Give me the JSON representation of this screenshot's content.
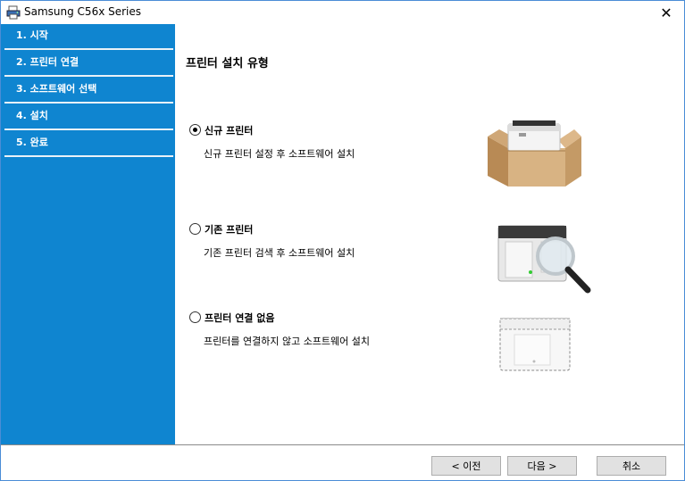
{
  "window": {
    "title": "Samsung C56x Series",
    "app_icon": "printer-icon",
    "close_glyph": "✕"
  },
  "sidebar": {
    "steps": [
      {
        "label": "1. 시작"
      },
      {
        "label": "2. 프린터 연결"
      },
      {
        "label": "3. 소프트웨어 선택"
      },
      {
        "label": "4. 설치"
      },
      {
        "label": "5. 완료"
      }
    ]
  },
  "main": {
    "heading": "프린터 설치 유형",
    "options": [
      {
        "label": "신규 프린터",
        "description": "신규 프린터 설정 후 소프트웨어 설치",
        "selected": true,
        "illustration": "printer-in-box-icon"
      },
      {
        "label": "기존 프린터",
        "description": "기존 프린터 검색 후 소프트웨어 설치",
        "selected": false,
        "illustration": "printer-search-icon"
      },
      {
        "label": "프린터 연결 없음",
        "description": "프린터를 연결하지 않고 소프트웨어 설치",
        "selected": false,
        "illustration": "printer-outline-icon"
      }
    ]
  },
  "footer": {
    "back_label": "< 이전",
    "next_label": "다음 >",
    "cancel_label": "취소"
  },
  "colors": {
    "sidebar_bg": "#0f85d0",
    "window_border": "#4a8dd6"
  }
}
